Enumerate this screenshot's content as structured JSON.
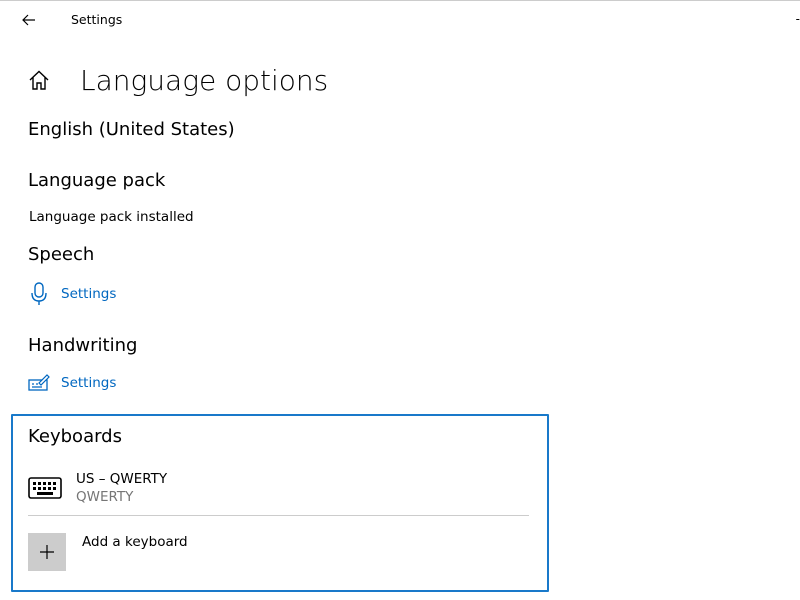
{
  "window": {
    "title": "Settings",
    "edge_glyph": "-"
  },
  "page": {
    "title": "Language options",
    "language": "English (United States)"
  },
  "language_pack": {
    "heading": "Language pack",
    "status": "Language pack installed"
  },
  "speech": {
    "heading": "Speech",
    "settings_label": "Settings",
    "icon": "microphone-icon"
  },
  "handwriting": {
    "heading": "Handwriting",
    "settings_label": "Settings",
    "icon": "pen-keyboard-icon"
  },
  "keyboards": {
    "heading": "Keyboards",
    "items": [
      {
        "name": "US – QWERTY",
        "layout": "QWERTY",
        "icon": "keyboard-icon"
      }
    ],
    "add_label": "Add a keyboard"
  },
  "colors": {
    "accent": "#0067c0",
    "focus_border": "#1979ca",
    "secondary_text": "#767676",
    "add_tile": "#cccccc"
  }
}
